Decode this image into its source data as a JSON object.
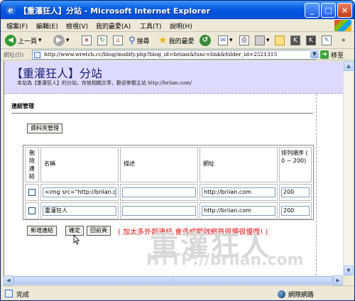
{
  "window": {
    "title": "【重灌狂人】分站 - Microsoft Internet Explorer",
    "controls": {
      "minimize": "_",
      "maximize": "□",
      "close": "×"
    }
  },
  "menubar": {
    "items": [
      "檔案(F)",
      "編輯(E)",
      "檢視(V)",
      "我的最愛(A)",
      "工具(T)",
      "說明(H)"
    ]
  },
  "toolbar": {
    "back_label": "上一頁",
    "search_label": "搜尋",
    "favorites_label": "我的最愛"
  },
  "address": {
    "label": "網址(D)",
    "url": "http://www.wretch.cc/blog/modify.php?blog_id=briian&func=link&folder_id=2521315",
    "go_label": "移至"
  },
  "page": {
    "blog_title": "【重灌狂人】分站",
    "blog_subtitle": "本站為【重灌狂人】的分站，存放相關文章，歡迎參觀主站 http://briian.com/",
    "section_title": "連結管理",
    "folder_button": "資料夾管理",
    "table": {
      "headers": {
        "delete": "刪除連結",
        "name": "名稱",
        "description": "描述",
        "url": "網址",
        "order": "排列順序 ( 0 ~ 200)"
      },
      "rows": [
        {
          "name": "<img src=\"http://briian.com",
          "description": "",
          "url": "http://briian.com",
          "order": "200"
        },
        {
          "name": "重灌狂人",
          "description": "",
          "url": "http://briian.com",
          "order": "200"
        }
      ]
    },
    "buttons": {
      "add": "新增連結",
      "confirm": "確定",
      "back": "回前頁"
    },
    "warning": "( 加太多外部連結,會造成開啟網頁很慢很慢喔! )",
    "watermark_main": "重灌狂人",
    "watermark_url": "HTTP://briian.com"
  },
  "status": {
    "text": "完成",
    "zone": "網際網路"
  },
  "colors": {
    "titlebar": "#0054e3",
    "header_bg": "#dedafe",
    "warning": "#e01010"
  }
}
